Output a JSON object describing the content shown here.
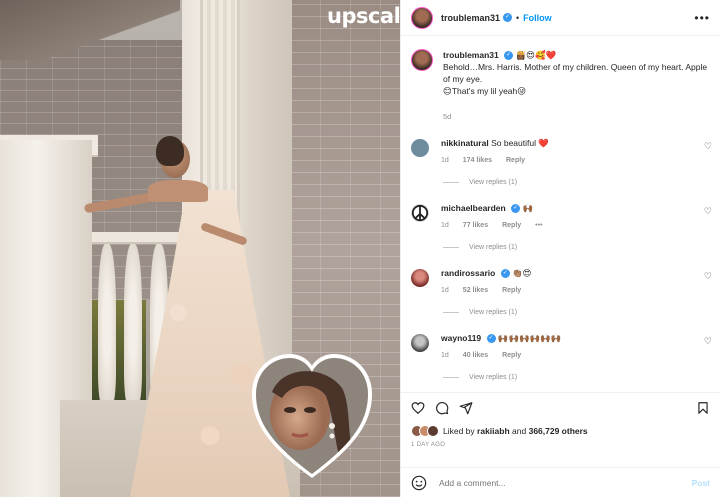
{
  "photo": {
    "watermark": "upscale"
  },
  "header": {
    "username": "troubleman31",
    "follow_label": "Follow",
    "more_label": "•••"
  },
  "caption": {
    "username": "troubleman31",
    "emojis": "👸🏾😍🥰❤️",
    "line1": "Behold…Mrs. Harris. Mother of my children. Queen of my heart. Apple of my eye.",
    "line2": "😊That's my lil yeah😜",
    "time": "5d"
  },
  "comments": [
    {
      "username": "nikkinatural",
      "verified": false,
      "text": "So beautiful ❤️",
      "time": "1d",
      "likes": "174 likes",
      "reply": "Reply",
      "view_replies": "View replies (1)",
      "avatar_color": "#6d8c9e"
    },
    {
      "username": "michaelbearden",
      "verified": true,
      "text": "🙌🏾",
      "time": "1d",
      "likes": "77 likes",
      "reply": "Reply",
      "extra": "•••",
      "view_replies": "View replies (1)",
      "avatar_color": "#ffffff"
    },
    {
      "username": "randirossario",
      "verified": true,
      "text": "👏🏽😍",
      "time": "1d",
      "likes": "52 likes",
      "reply": "Reply",
      "view_replies": "View replies (1)",
      "avatar_color": "#b0413e"
    },
    {
      "username": "wayno119",
      "verified": true,
      "text": "🙌🏾🙌🏾🙌🏾🙌🏾🙌🏾🙌🏾",
      "time": "1d",
      "likes": "40 likes",
      "reply": "Reply",
      "view_replies": "View replies (1)",
      "avatar_color": "#555555"
    }
  ],
  "likes": {
    "prefix": "Liked by",
    "user": "rakiiabh",
    "joiner": "and",
    "count": "366,729 others",
    "ago": "1 DAY AGO"
  },
  "add_comment": {
    "placeholder": "Add a comment...",
    "post_label": "Post"
  },
  "icons": [
    "heart-icon",
    "comment-icon",
    "share-icon",
    "bookmark-icon",
    "emoji-icon",
    "peace-icon"
  ]
}
